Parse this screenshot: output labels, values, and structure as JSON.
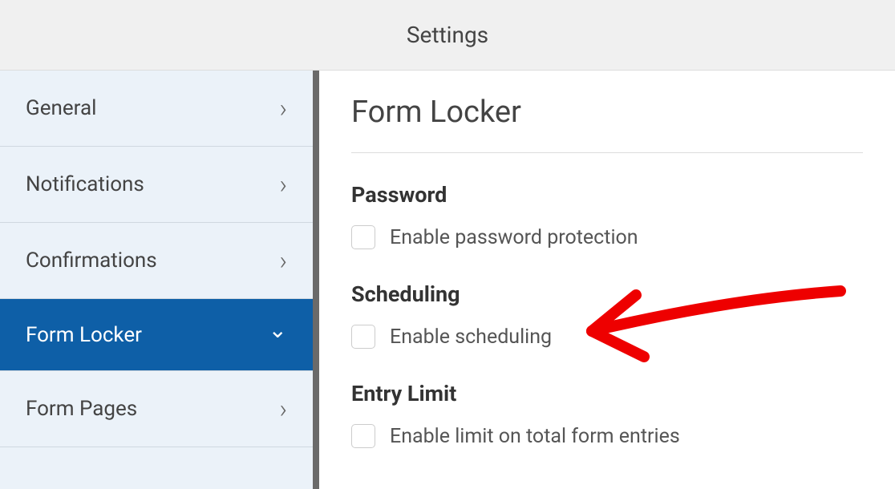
{
  "header": {
    "title": "Settings"
  },
  "sidebar": {
    "items": [
      {
        "label": "General",
        "active": false
      },
      {
        "label": "Notifications",
        "active": false
      },
      {
        "label": "Confirmations",
        "active": false
      },
      {
        "label": "Form Locker",
        "active": true
      },
      {
        "label": "Form Pages",
        "active": false
      }
    ]
  },
  "content": {
    "title": "Form Locker",
    "sections": {
      "password": {
        "heading": "Password",
        "checkbox_label": "Enable password protection"
      },
      "scheduling": {
        "heading": "Scheduling",
        "checkbox_label": "Enable scheduling"
      },
      "entry_limit": {
        "heading": "Entry Limit",
        "checkbox_label": "Enable limit on total form entries"
      }
    }
  }
}
